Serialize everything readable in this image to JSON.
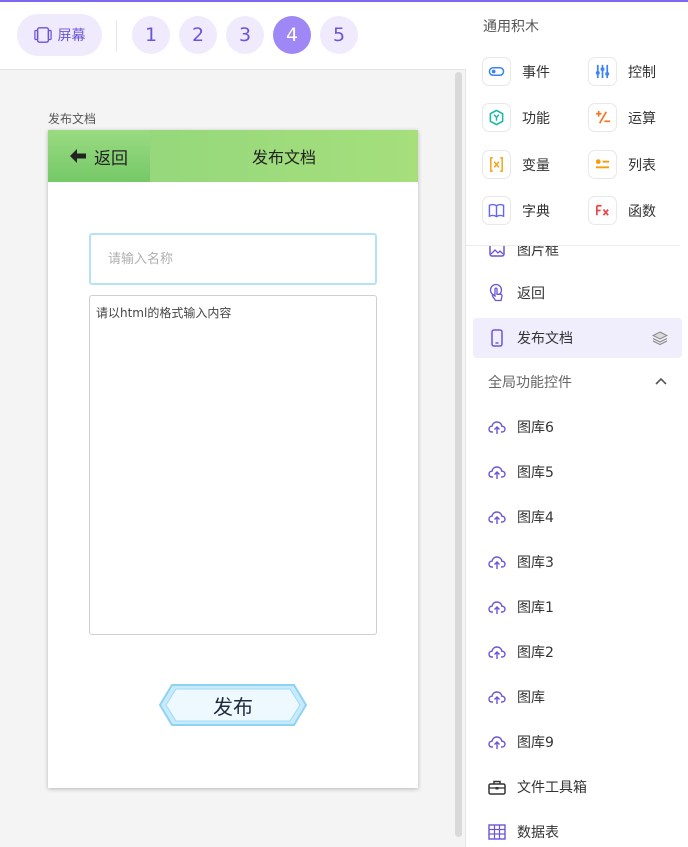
{
  "toolbar": {
    "screen_label": "屏幕",
    "pages": [
      "1",
      "2",
      "3",
      "4",
      "5"
    ],
    "active_page": "4"
  },
  "canvas": {
    "frame_label": "发布文档",
    "header": {
      "back_label": "返回",
      "title": "发布文档"
    },
    "name_input": {
      "placeholder": "请输入名称",
      "value": ""
    },
    "content_input": {
      "placeholder": "请以html的格式输入内容",
      "value": ""
    },
    "publish_button": "发布"
  },
  "palette": {
    "title": "通用积木",
    "blocks": [
      {
        "label": "事件",
        "icon": "toggle-icon",
        "color": "#3b82f6"
      },
      {
        "label": "控制",
        "icon": "sliders-icon",
        "color": "#3b82f6"
      },
      {
        "label": "功能",
        "icon": "hexagon-icon",
        "color": "#14b8a6"
      },
      {
        "label": "运算",
        "icon": "calculator-icon",
        "color": "#f97316"
      },
      {
        "label": "变量",
        "icon": "variable-icon",
        "color": "#f59e0b"
      },
      {
        "label": "列表",
        "icon": "list-icon",
        "color": "#f59e0b"
      },
      {
        "label": "字典",
        "icon": "book-icon",
        "color": "#6366f1"
      },
      {
        "label": "函数",
        "icon": "function-icon",
        "color": "#ef4444"
      }
    ]
  },
  "component_tree": {
    "items": [
      {
        "label": "图片框",
        "icon": "image-icon"
      },
      {
        "label": "返回",
        "icon": "touch-icon"
      },
      {
        "label": "发布文档",
        "icon": "phone-icon",
        "selected": true
      }
    ],
    "group": {
      "label": "全局功能控件",
      "expanded": true,
      "items": [
        {
          "label": "图库6",
          "icon": "cloud-upload-icon"
        },
        {
          "label": "图库5",
          "icon": "cloud-upload-icon"
        },
        {
          "label": "图库4",
          "icon": "cloud-upload-icon"
        },
        {
          "label": "图库3",
          "icon": "cloud-upload-icon"
        },
        {
          "label": "图库1",
          "icon": "cloud-upload-icon"
        },
        {
          "label": "图库2",
          "icon": "cloud-upload-icon"
        },
        {
          "label": "图库",
          "icon": "cloud-upload-icon"
        },
        {
          "label": "图库9",
          "icon": "cloud-upload-icon"
        },
        {
          "label": "文件工具箱",
          "icon": "toolbox-icon"
        },
        {
          "label": "数据表",
          "icon": "table-icon"
        }
      ]
    }
  },
  "colors": {
    "accent": "#7b68ee",
    "active_page": "#9f87f5",
    "header_green": "#a6df7c",
    "selected_bg": "#f0eefc"
  }
}
